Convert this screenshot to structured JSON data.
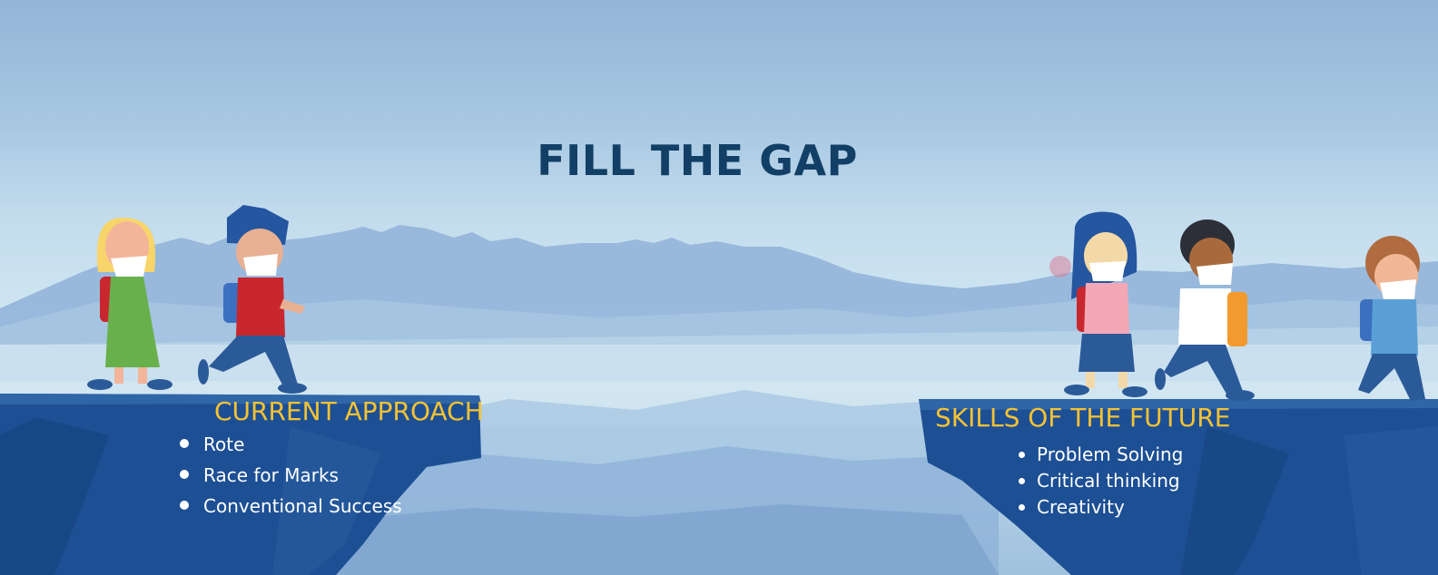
{
  "title": "FILL THE GAP",
  "left_cliff": {
    "heading": "CURRENT APPROACH",
    "items": [
      "Rote",
      "Race for Marks",
      "Conventional Success"
    ]
  },
  "right_cliff": {
    "heading": "SKILLS OF THE FUTURE",
    "items": [
      "Problem Solving",
      "Critical thinking",
      "Creativity"
    ]
  },
  "colors": {
    "title": "#123f66",
    "heading": "#f5c233",
    "cliff": "#1d4f94",
    "sky": "#a8c8e2",
    "text": "#ffffff"
  }
}
